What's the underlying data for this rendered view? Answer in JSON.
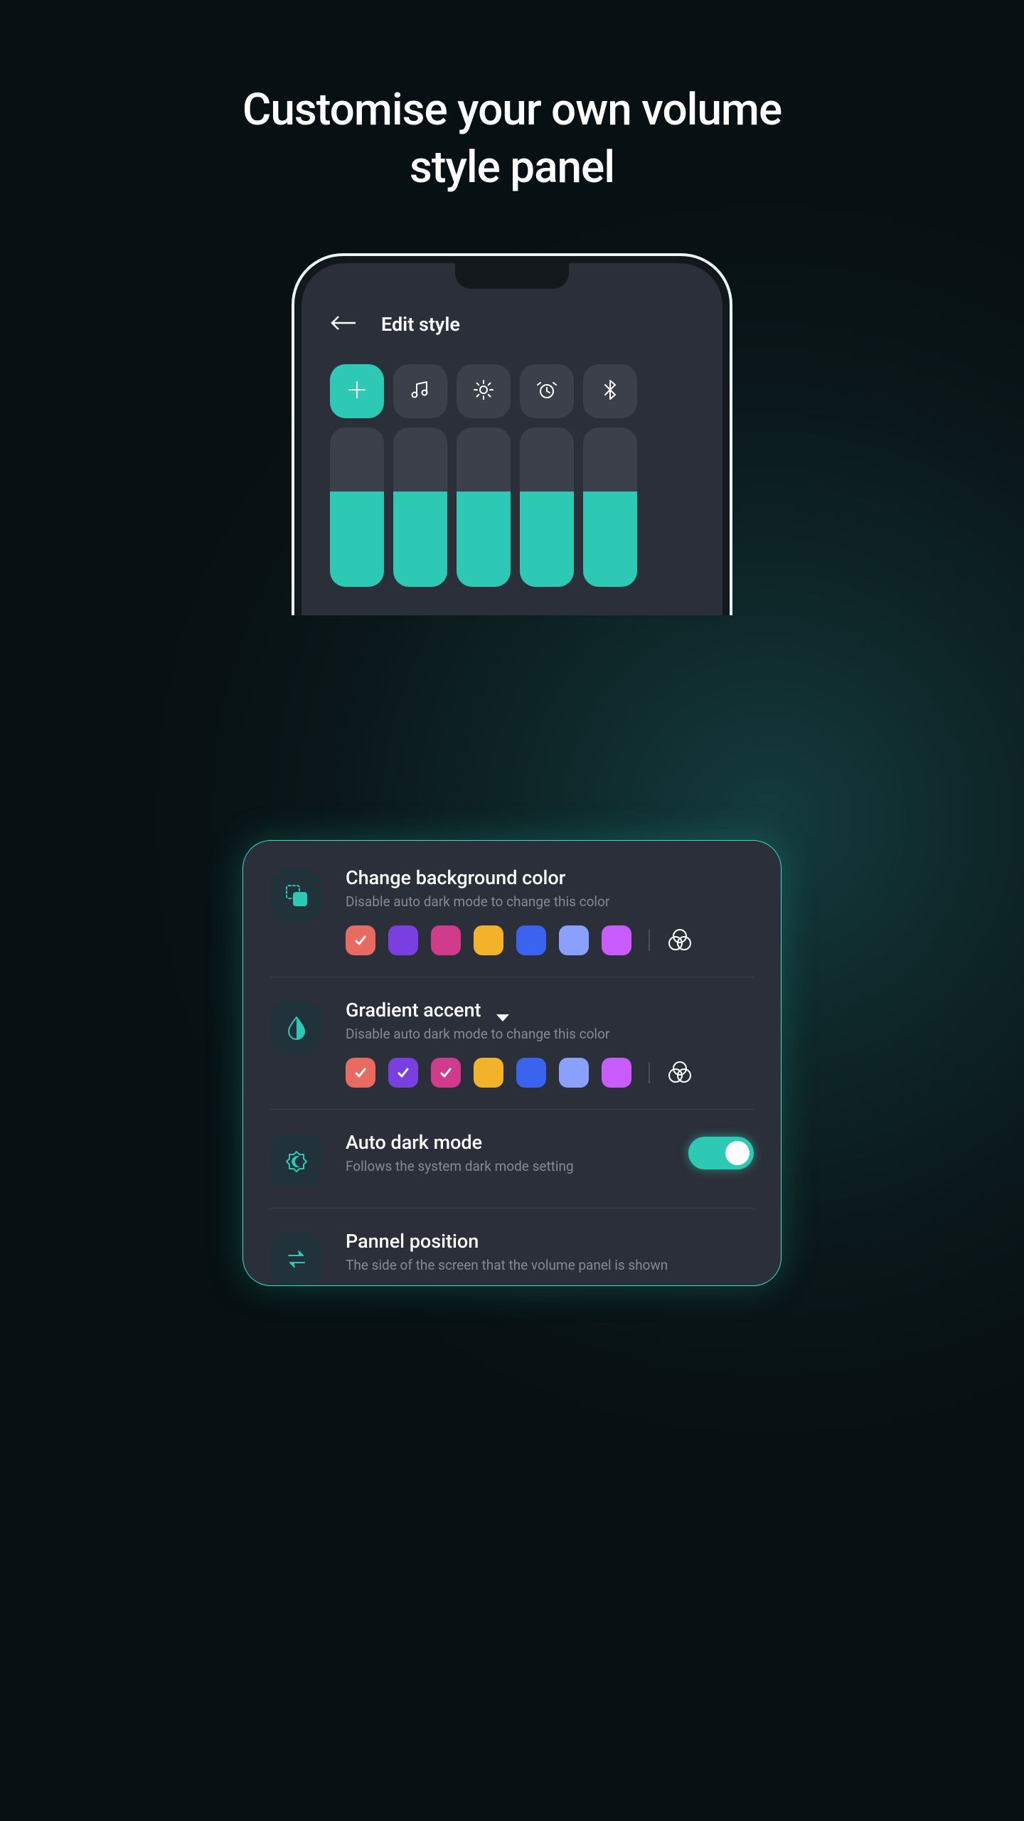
{
  "headline": "Customise your own volume style panel",
  "phone": {
    "app_title": "Edit style",
    "tiles": [
      {
        "name": "plus-icon",
        "active": true
      },
      {
        "name": "music-icon",
        "active": false
      },
      {
        "name": "brightness-icon",
        "active": false
      },
      {
        "name": "alarm-icon",
        "active": false
      },
      {
        "name": "bluetooth-icon",
        "active": false
      }
    ],
    "slider_fill_percent": 60,
    "slider_count": 5
  },
  "colors": {
    "accent": "#2dc9b5",
    "swatches": [
      "#e76b60",
      "#7a3fe0",
      "#d13b8c",
      "#f2b22a",
      "#3a64f0",
      "#8aa0ff",
      "#c85cff"
    ]
  },
  "settings": {
    "bg": {
      "title": "Change background color",
      "desc": "Disable auto dark mode to change this color",
      "selected": [
        0
      ]
    },
    "gradient": {
      "title": "Gradient accent",
      "desc": "Disable auto dark mode to change this color",
      "selected": [
        0,
        1,
        2
      ]
    },
    "dark": {
      "title": "Auto dark mode",
      "desc": "Follows the system dark mode setting",
      "enabled": true
    },
    "position": {
      "title": "Pannel position",
      "desc": "The side of the screen that the volume panel is shown"
    }
  }
}
